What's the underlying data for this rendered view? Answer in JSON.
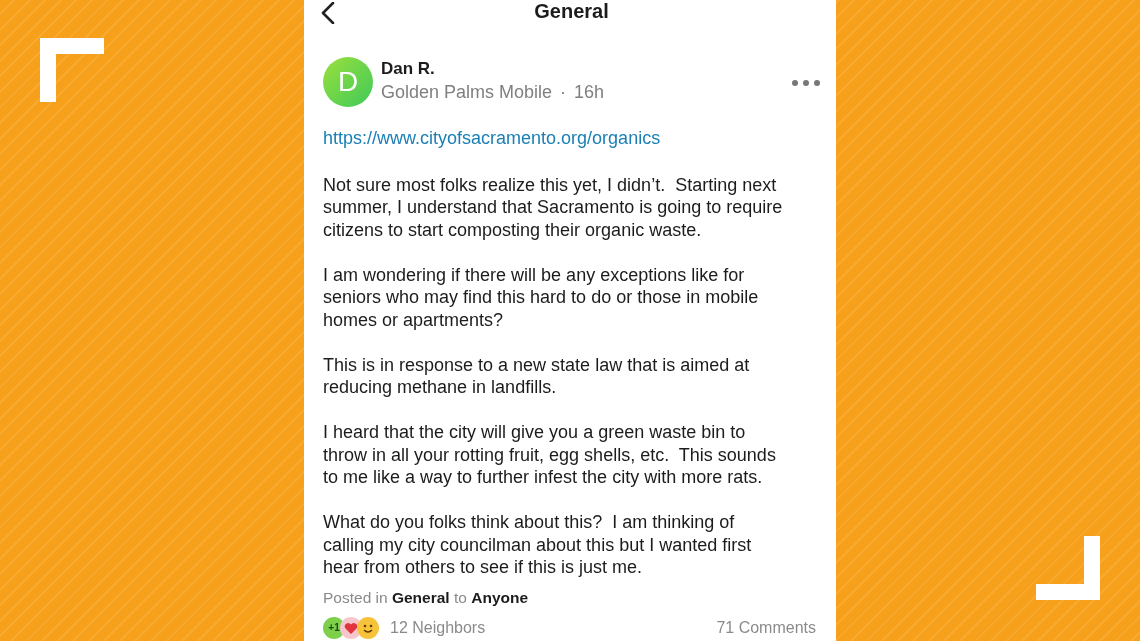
{
  "header": {
    "title": "General"
  },
  "post": {
    "author": "Dan R.",
    "avatar_letter": "D",
    "community": "Golden Palms Mobile",
    "separator": "·",
    "time": "16h",
    "link": "https://www.cityofsacramento.org/organics",
    "paragraphs": [
      [
        "Not sure most folks realize this yet, I didn’t.  Starting next",
        "summer, I understand that Sacramento is going to require",
        "citizens to start composting their organic waste."
      ],
      [
        "I am wondering if there will be any exceptions like for",
        "seniors who may find this hard to do or those in mobile",
        "homes or apartments?"
      ],
      [
        "This is in response to a new state law that is aimed at",
        "reducing methane in landfills."
      ],
      [
        "I heard that the city will give you a green waste bin to",
        "throw in all your rotting fruit, egg shells, etc.  This sounds",
        "to me like a way to further infest the city with more rats."
      ],
      [
        "What do you folks think about this?  I am thinking of",
        "calling my city councilman about this but I wanted first",
        "hear from others to see if this is just me."
      ]
    ],
    "posted_in": "Posted in **General** to **Anyone**"
  },
  "footer": {
    "reactions": [
      {
        "kind": "plus_one",
        "label": "+1"
      },
      {
        "kind": "heart"
      },
      {
        "kind": "smile"
      }
    ],
    "neighbors": "12 Neighbors",
    "comments": "71 Comments"
  }
}
